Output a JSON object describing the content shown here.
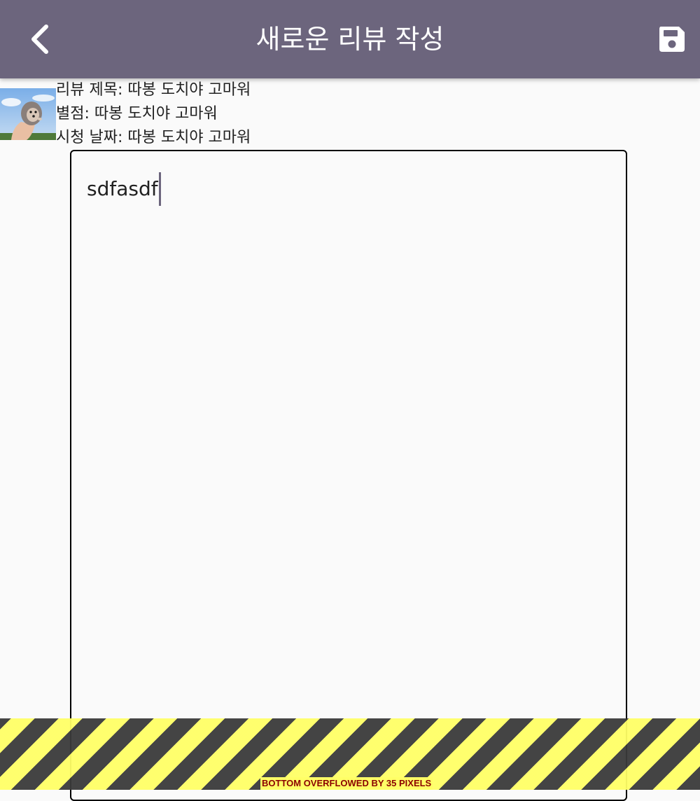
{
  "app_bar": {
    "title": "새로운 리뷰 작성",
    "back_icon": "chevron-left-icon",
    "save_icon": "floppy-disk-icon",
    "background_color": "#6c657d"
  },
  "movie": {
    "poster_icon": "hedgehog-photo",
    "title_line": "리뷰 제목: 따봉 도치야 고마워",
    "rating_line": "별점: 따봉 도치야 고마워",
    "date_line": "시청 날짜: 따봉 도치야 고마워"
  },
  "review_input": {
    "value": "sdfasdf"
  },
  "overflow_warning": {
    "text": "BOTTOM OVERFLOWED BY 35 PIXELS"
  }
}
